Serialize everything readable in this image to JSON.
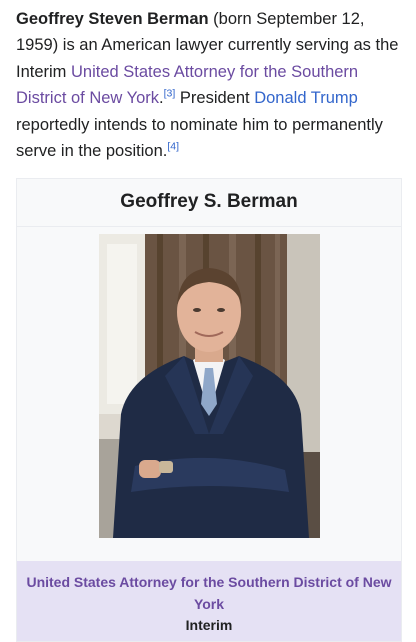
{
  "intro": {
    "name_bold": "Geoffrey Steven Berman",
    "text1": " (born September 12, 1959) is an American lawyer currently serving as the Interim ",
    "link1": "United States Attorney for the Southern District of New York",
    "text2": ".",
    "ref1": "[3]",
    "text3": " President ",
    "link2": "Donald Trump",
    "text4": " reportedly intends to nominate him to permanently serve in the position.",
    "ref2": "[4]"
  },
  "infobox": {
    "title": "Geoffrey S. Berman",
    "office": "United States Attorney for the Southern District of New York",
    "status": "Interim"
  },
  "colors": {
    "link": "#3366cc",
    "visited_link": "#6b4ba1",
    "infobox_bg": "#f8f9fa",
    "office_bg": "#e5e1f4"
  }
}
